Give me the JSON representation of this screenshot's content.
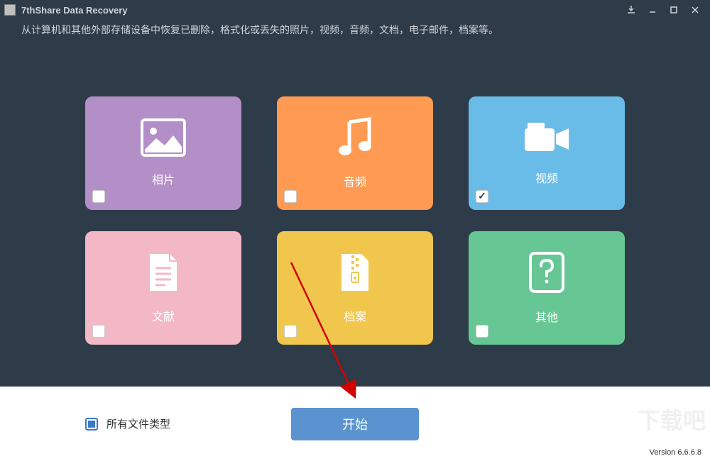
{
  "app": {
    "title": "7thShare Data Recovery",
    "subtitle": "从计算机和其他外部存储设备中恢复已删除，格式化或丢失的照片，视频，音频，文档，电子邮件，档案等。",
    "version": "Version 6.6.6.8"
  },
  "cards": {
    "photo": {
      "label": "相片"
    },
    "audio": {
      "label": "音频"
    },
    "video": {
      "label": "视频"
    },
    "doc": {
      "label": "文献"
    },
    "archive": {
      "label": "档案"
    },
    "other": {
      "label": "其他"
    }
  },
  "footer": {
    "all_types": "所有文件类型",
    "start": "开始"
  }
}
